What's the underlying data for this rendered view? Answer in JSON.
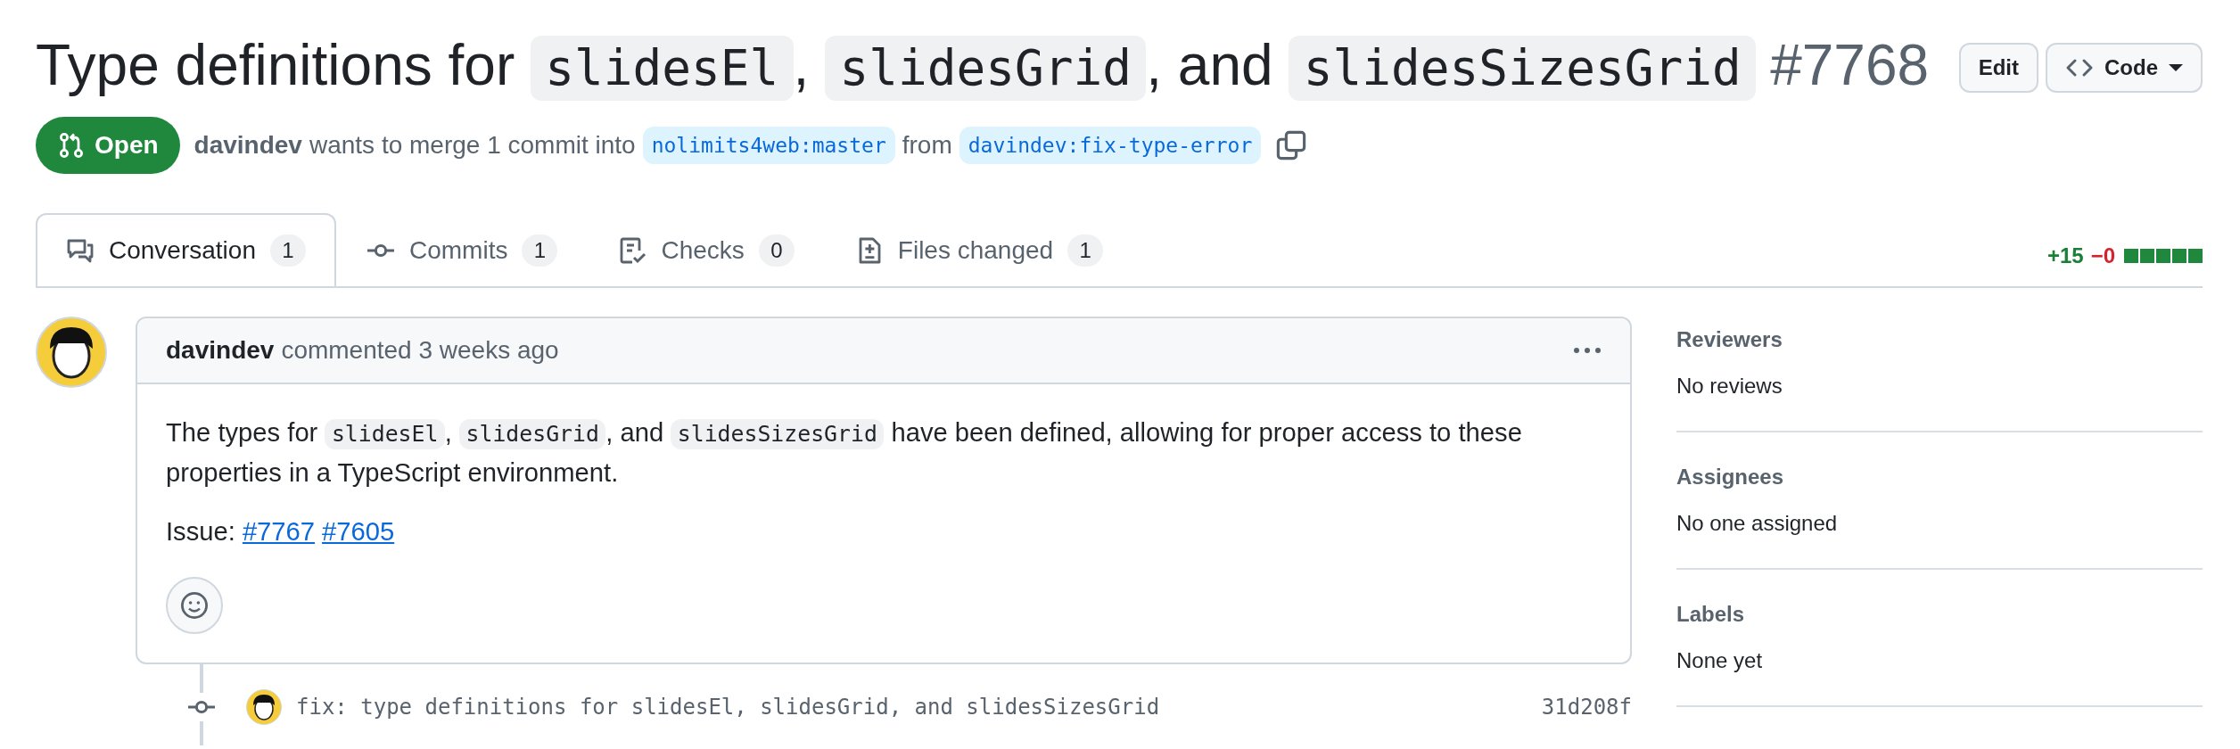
{
  "title": {
    "parts": [
      {
        "kind": "text",
        "text": "Type definitions for "
      },
      {
        "kind": "code",
        "text": "slidesEl"
      },
      {
        "kind": "text",
        "text": ", "
      },
      {
        "kind": "code",
        "text": "slidesGrid"
      },
      {
        "kind": "text",
        "text": ", and "
      },
      {
        "kind": "code",
        "text": "slidesSizesGrid"
      }
    ],
    "number": "#7768"
  },
  "header_buttons": [
    {
      "kind": "plain",
      "label": "Edit"
    },
    {
      "kind": "code",
      "label": "Code"
    }
  ],
  "state": {
    "label": "Open"
  },
  "merge": {
    "author": "davindev",
    "text": "wants to merge 1 commit into",
    "base": "nolimits4web:master",
    "from": "from",
    "head": "davindev:fix-type-error"
  },
  "tabs": [
    {
      "kind": "conversation",
      "label": "Conversation",
      "count": "1",
      "selected": true
    },
    {
      "kind": "commits",
      "label": "Commits",
      "count": "1",
      "selected": false
    },
    {
      "kind": "checks",
      "label": "Checks",
      "count": "0",
      "selected": false
    },
    {
      "kind": "files",
      "label": "Files changed",
      "count": "1",
      "selected": false
    }
  ],
  "diffstat": {
    "additions": "+15",
    "deletions": "−0",
    "blocks": [
      {
        "kind": "added"
      },
      {
        "kind": "added"
      },
      {
        "kind": "added"
      },
      {
        "kind": "added"
      },
      {
        "kind": "added"
      }
    ]
  },
  "comment": {
    "author": "davindev",
    "meta": "commented 3 weeks ago",
    "body": [
      {
        "kind": "text",
        "text": "The types for "
      },
      {
        "kind": "code",
        "text": "slidesEl"
      },
      {
        "kind": "text",
        "text": ", "
      },
      {
        "kind": "code",
        "text": "slidesGrid"
      },
      {
        "kind": "text",
        "text": ", and "
      },
      {
        "kind": "code",
        "text": "slidesSizesGrid"
      },
      {
        "kind": "text",
        "text": " have been defined, allowing for proper access to these properties in a TypeScript environment."
      }
    ],
    "issue_label": "Issue:",
    "issue_links": [
      "#7767",
      "#7605"
    ]
  },
  "commit": {
    "message": "fix: type definitions for slidesEl, slidesGrid, and slidesSizesGrid",
    "sha": "31d208f"
  },
  "sidebar": [
    {
      "heading": "Reviewers",
      "value": "No reviews"
    },
    {
      "heading": "Assignees",
      "value": "No one assigned"
    },
    {
      "heading": "Labels",
      "value": "None yet"
    }
  ]
}
